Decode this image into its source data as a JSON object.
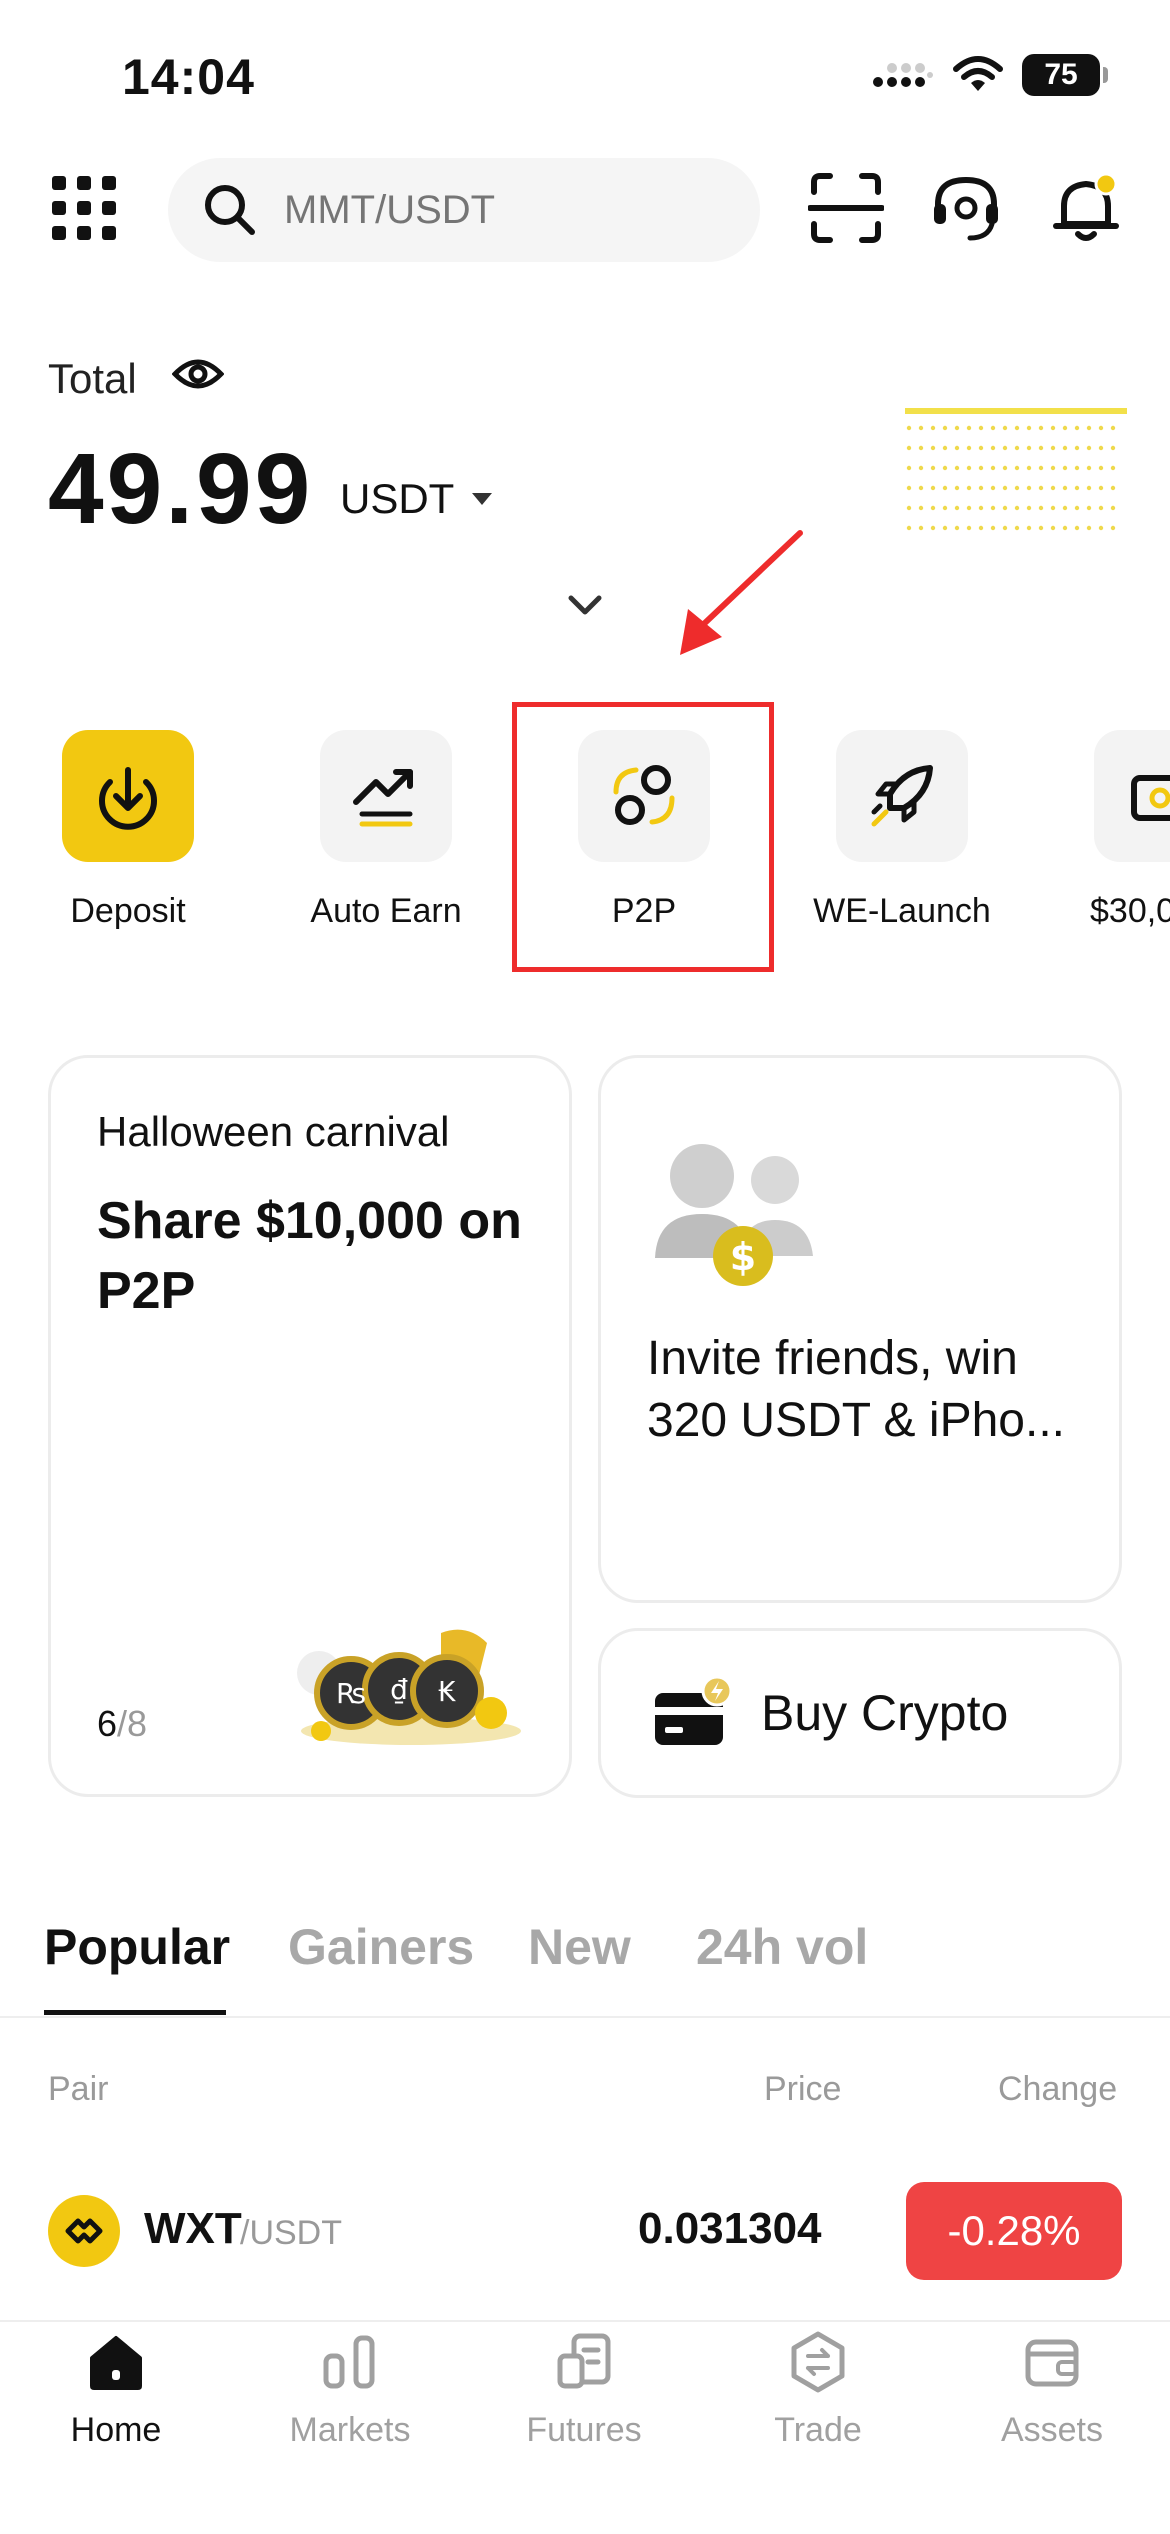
{
  "status_bar": {
    "time": "14:04",
    "battery": "75"
  },
  "search": {
    "placeholder": "MMT/USDT"
  },
  "balance": {
    "label": "Total",
    "amount": "49.99",
    "currency": "USDT"
  },
  "quick_actions": [
    {
      "label": "Deposit",
      "icon": "download-icon"
    },
    {
      "label": "Auto Earn",
      "icon": "trend-up-icon"
    },
    {
      "label": "P2P",
      "icon": "p2p-exchange-icon"
    },
    {
      "label": "WE-Launch",
      "icon": "rocket-icon"
    },
    {
      "label": "$30,0",
      "icon": "gift-icon"
    }
  ],
  "promo_left": {
    "title": "Halloween carnival",
    "headline": "Share $10,000 on P2P",
    "page_current": "6",
    "page_total": "/8"
  },
  "promo_right": {
    "text_line1": "Invite friends, win",
    "text_line2": "320 USDT & iPho..."
  },
  "buy_crypto": {
    "label": "Buy Crypto"
  },
  "market_tabs": [
    {
      "label": "Popular",
      "active": true
    },
    {
      "label": "Gainers",
      "active": false
    },
    {
      "label": "New",
      "active": false
    },
    {
      "label": "24h vol",
      "active": false
    }
  ],
  "table": {
    "columns": {
      "pair": "Pair",
      "price": "Price",
      "change": "Change"
    },
    "rows": [
      {
        "base": "WXT",
        "quote": "/USDT",
        "price": "0.031304",
        "change": "-0.28%"
      }
    ]
  },
  "bottom_nav": [
    {
      "label": "Home",
      "active": true
    },
    {
      "label": "Markets",
      "active": false
    },
    {
      "label": "Futures",
      "active": false
    },
    {
      "label": "Trade",
      "active": false
    },
    {
      "label": "Assets",
      "active": false
    }
  ],
  "colors": {
    "accent": "#F2C811",
    "negative": "#EF4444",
    "annotation": "#EE2C2C"
  }
}
